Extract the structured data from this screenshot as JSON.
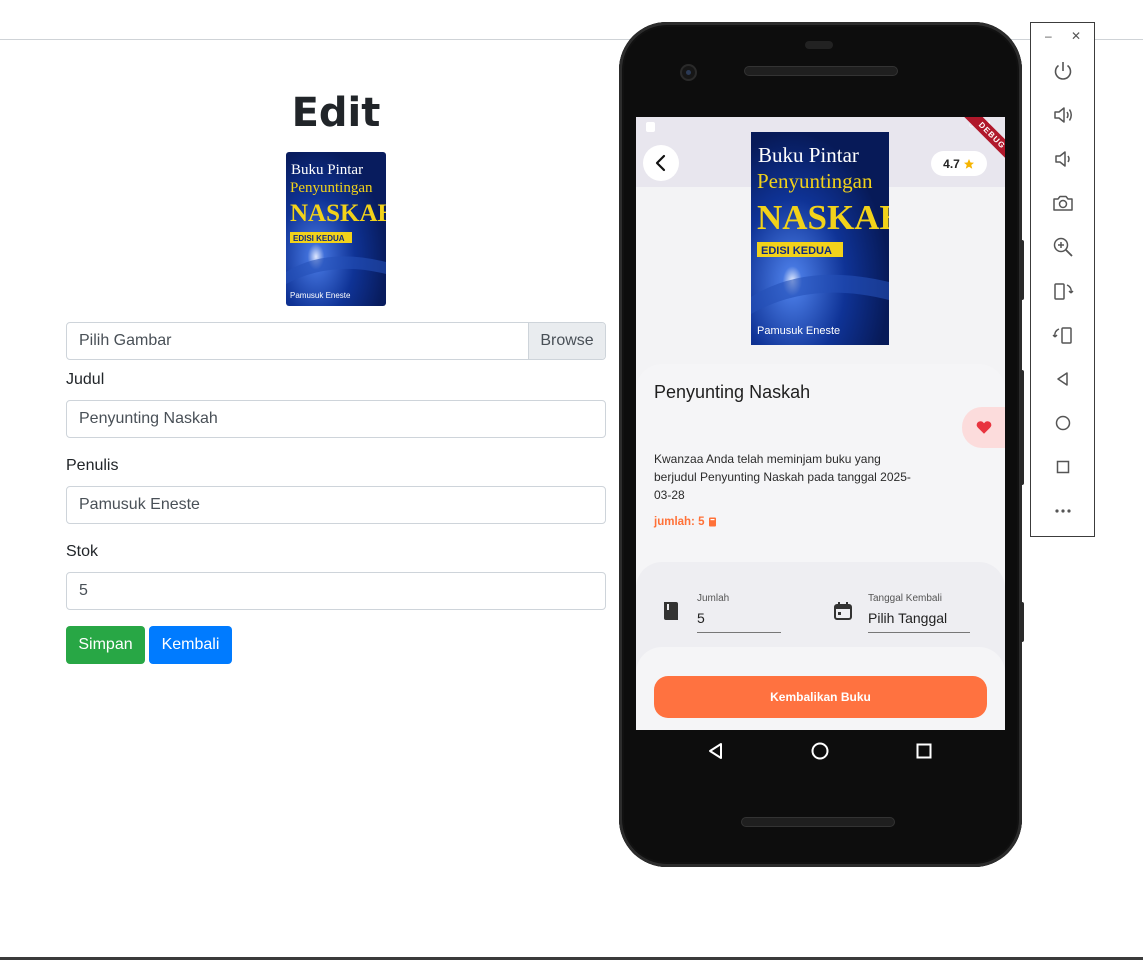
{
  "web": {
    "title": "Edit",
    "file_input": {
      "placeholder": "Pilih Gambar",
      "browse_label": "Browse"
    },
    "fields": {
      "judul": {
        "label": "Judul",
        "value": "Penyunting Naskah"
      },
      "penulis": {
        "label": "Penulis",
        "value": "Pamusuk Eneste"
      },
      "stok": {
        "label": "Stok",
        "value": "5"
      }
    },
    "buttons": {
      "save": "Simpan",
      "back": "Kembali"
    },
    "colors": {
      "save": "#28a745",
      "back": "#007bff"
    }
  },
  "cover": {
    "line1": "Buku Pintar",
    "line2": "Penyuntingan",
    "line3": "NASKAH",
    "edition": "EDISI KEDUA",
    "author": "Pamusuk Eneste"
  },
  "app": {
    "rating": "4.7",
    "debug_banner": "DEBUG",
    "book_title": "Penyunting Naskah",
    "description": "Kwanzaa Anda telah meminjam buku yang berjudul Penyunting Naskah pada tanggal 2025-03-28",
    "quantity_text": "jumlah: 5",
    "jumlah_field": {
      "label": "Jumlah",
      "value": "5"
    },
    "tanggal_field": {
      "label": "Tanggal Kembali",
      "value": "Pilih Tanggal"
    },
    "return_button": "Kembalikan Buku",
    "colors": {
      "accent": "#ff7240",
      "favorite": "#e8343f",
      "star": "#f6b400"
    }
  },
  "toolbar": {
    "icons": [
      "power-icon",
      "volume-up-icon",
      "volume-down-icon",
      "camera-icon",
      "zoom-in-icon",
      "rotate-left-icon",
      "rotate-right-icon",
      "back-icon",
      "home-icon",
      "overview-icon",
      "more-icon"
    ]
  }
}
